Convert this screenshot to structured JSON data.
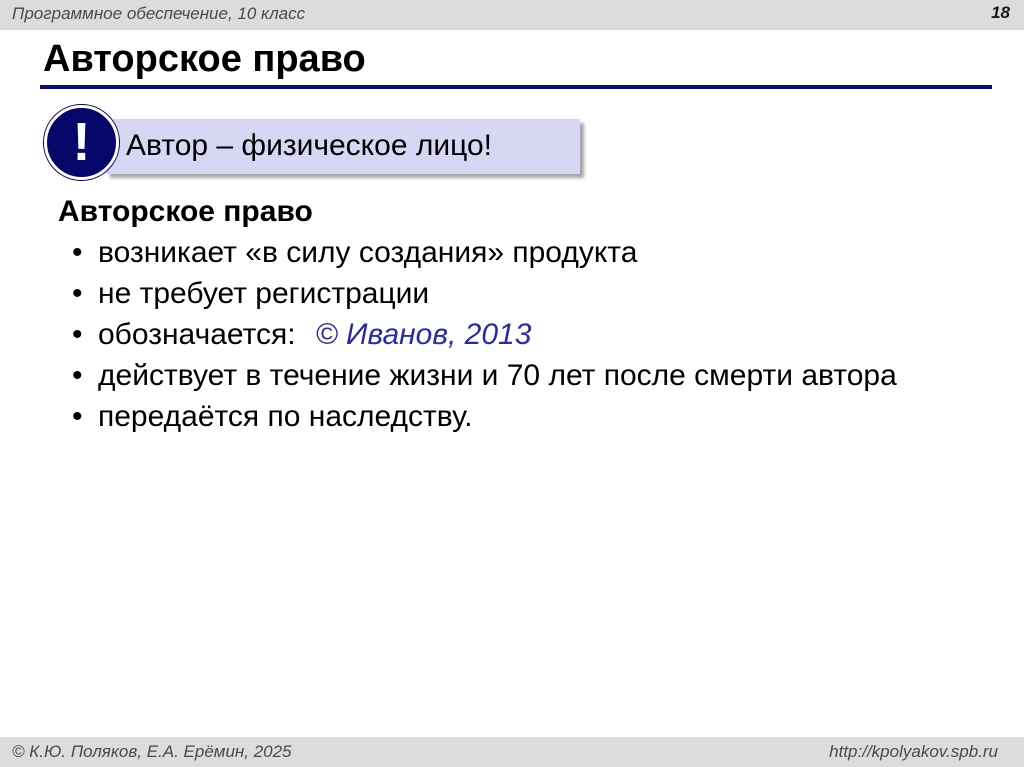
{
  "header": {
    "course": "Программное обеспечение, 10 класс",
    "slide_number": "18"
  },
  "title": "Авторское право",
  "callout": {
    "icon": "exclamation-icon",
    "icon_glyph": "!",
    "text": "Автор – физическое лицо!"
  },
  "body": {
    "heading": "Авторское право",
    "bullet_glyph": "•",
    "items": [
      {
        "text": "возникает «в силу создания» продукта"
      },
      {
        "text": "не требует регистрации"
      },
      {
        "text": "обозначается:",
        "sample": "© Иванов, 2013"
      },
      {
        "text": "действует в течение жизни и 70 лет после смерти автора"
      },
      {
        "text": "передаётся по наследству."
      }
    ]
  },
  "footer": {
    "authors": "© К.Ю. Поляков, Е.А. Ерёмин, 2025",
    "url": "http://kpolyakov.spb.ru"
  },
  "colors": {
    "title_rule": "#0b0b7a",
    "callout_bg": "#d7d7f3",
    "alert_circle": "#06066a",
    "sample_text": "#2a2aa8",
    "bars": "#dcdcdc"
  }
}
